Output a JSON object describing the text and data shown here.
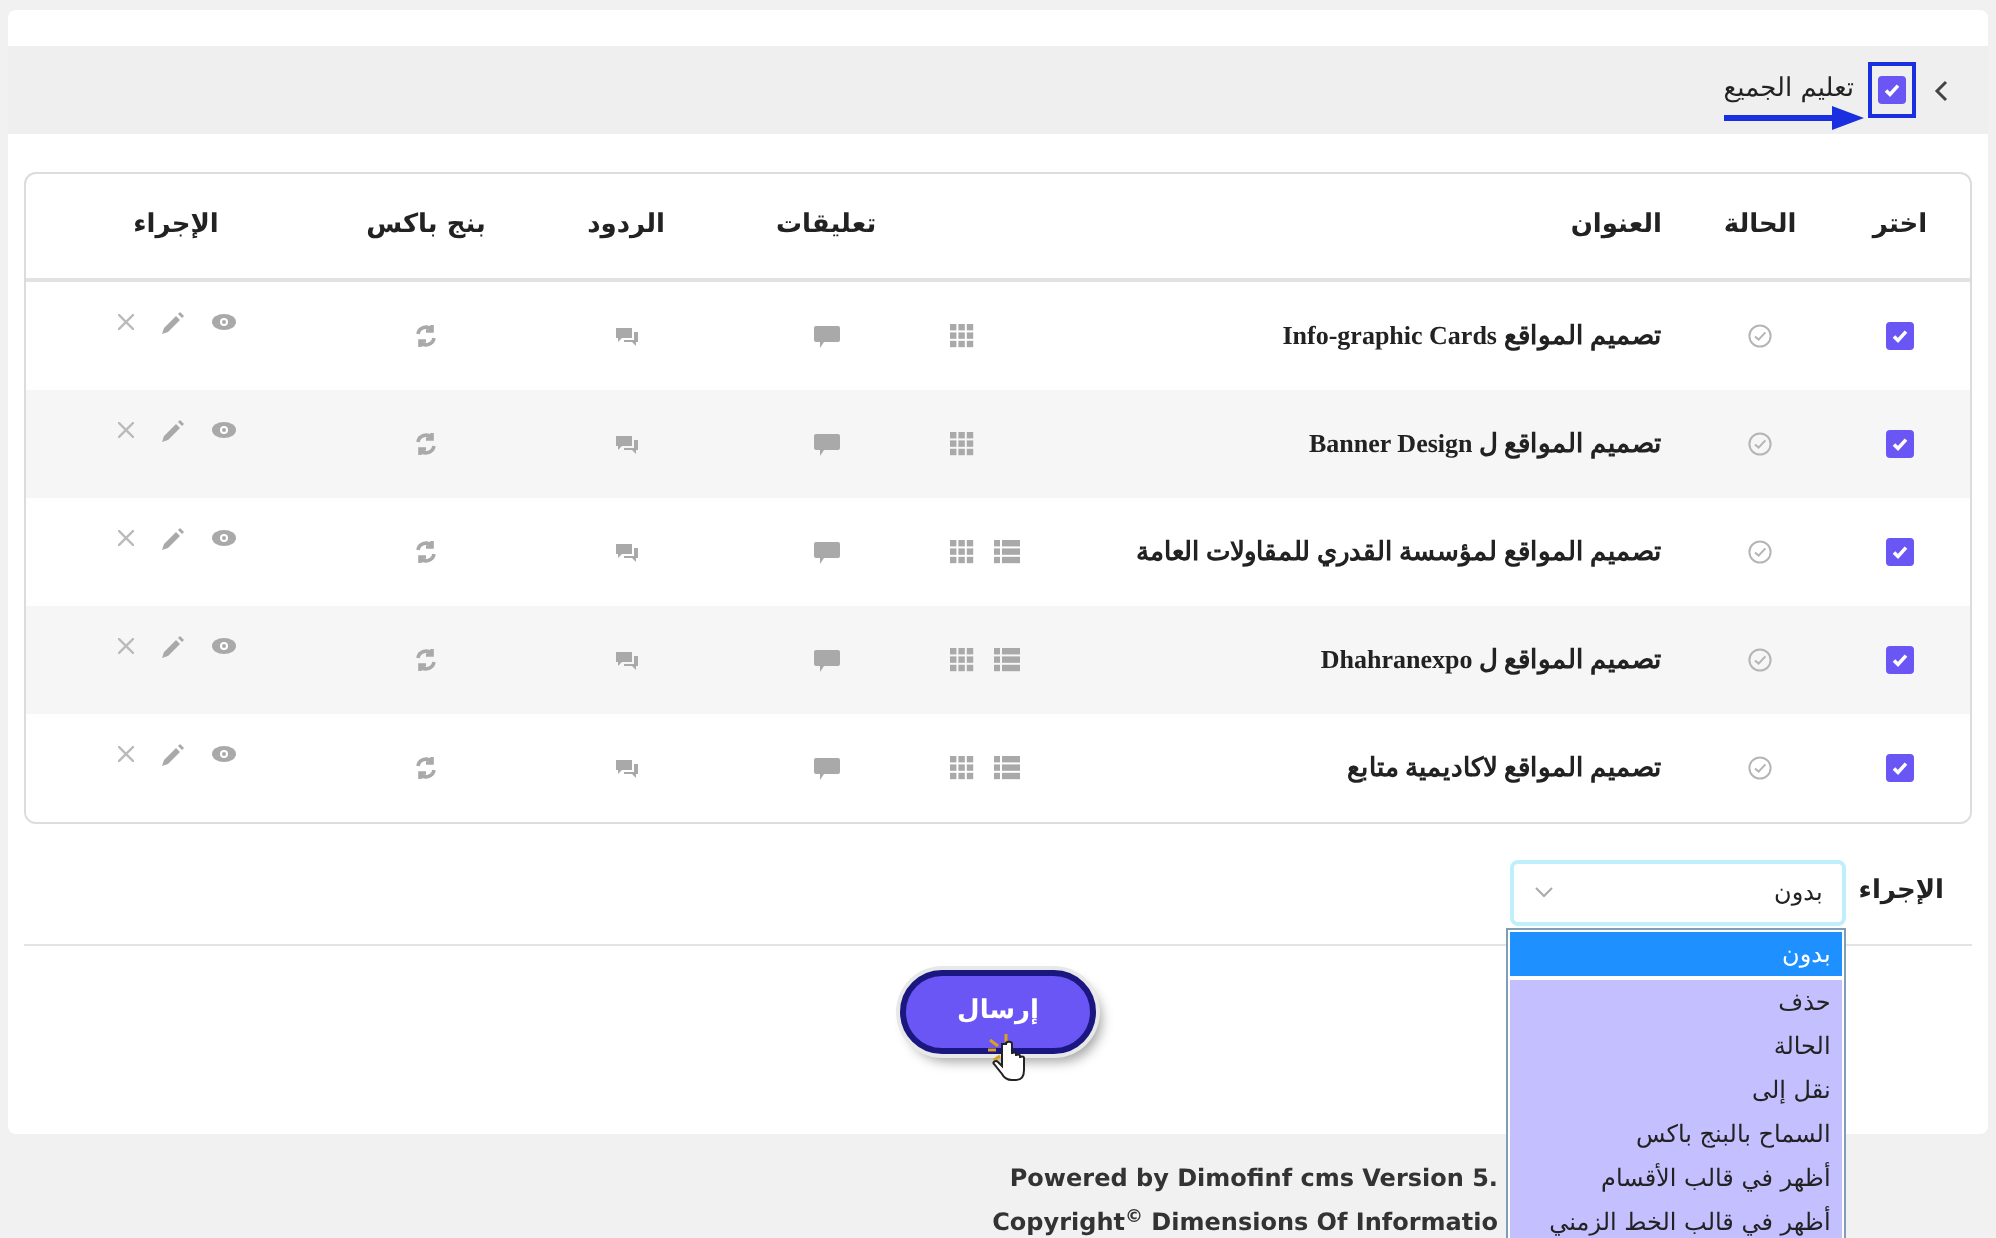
{
  "toolbar": {
    "select_all": {
      "label": "تعليم الجميع",
      "checked": true
    }
  },
  "table": {
    "columns": [
      "اختر",
      "الحالة",
      "العنوان",
      "تعليقات",
      "الردود",
      "بنج باكس",
      "الإجراء"
    ],
    "rows": [
      {
        "checked": true,
        "title": "تصميم المواقع Info-graphic Cards",
        "has_list_view": false
      },
      {
        "checked": true,
        "title": "تصميم المواقع ل Banner Design",
        "has_list_view": false
      },
      {
        "checked": true,
        "title": "تصميم المواقع لمؤسسة القدري للمقاولات العامة",
        "has_list_view": true
      },
      {
        "checked": true,
        "title": "تصميم المواقع ل Dhahranexpo",
        "has_list_view": true
      },
      {
        "checked": true,
        "title": "تصميم المواقع لاكاديمية متابع",
        "has_list_view": true
      }
    ]
  },
  "action": {
    "label": "الإجراء",
    "value": "بدون",
    "expanded": true,
    "options": [
      {
        "label": "بدون",
        "selected": true
      },
      {
        "label": "حذف",
        "selected": false
      },
      {
        "label": "الحالة",
        "selected": false
      },
      {
        "label": "نقل إلى",
        "selected": false
      },
      {
        "label": "السماح بالبنج باكس",
        "selected": false
      },
      {
        "label": "أظهر في قالب الأقسام",
        "selected": false
      },
      {
        "label": "أظهر في قالب الخط الزمني",
        "selected": false
      }
    ]
  },
  "submit": "إرسال",
  "footer": [
    "Powered by **Dimofinf cms** Version 5.",
    "Copyright$^{©}$ Dimensions Of Informatio"
  ]
}
